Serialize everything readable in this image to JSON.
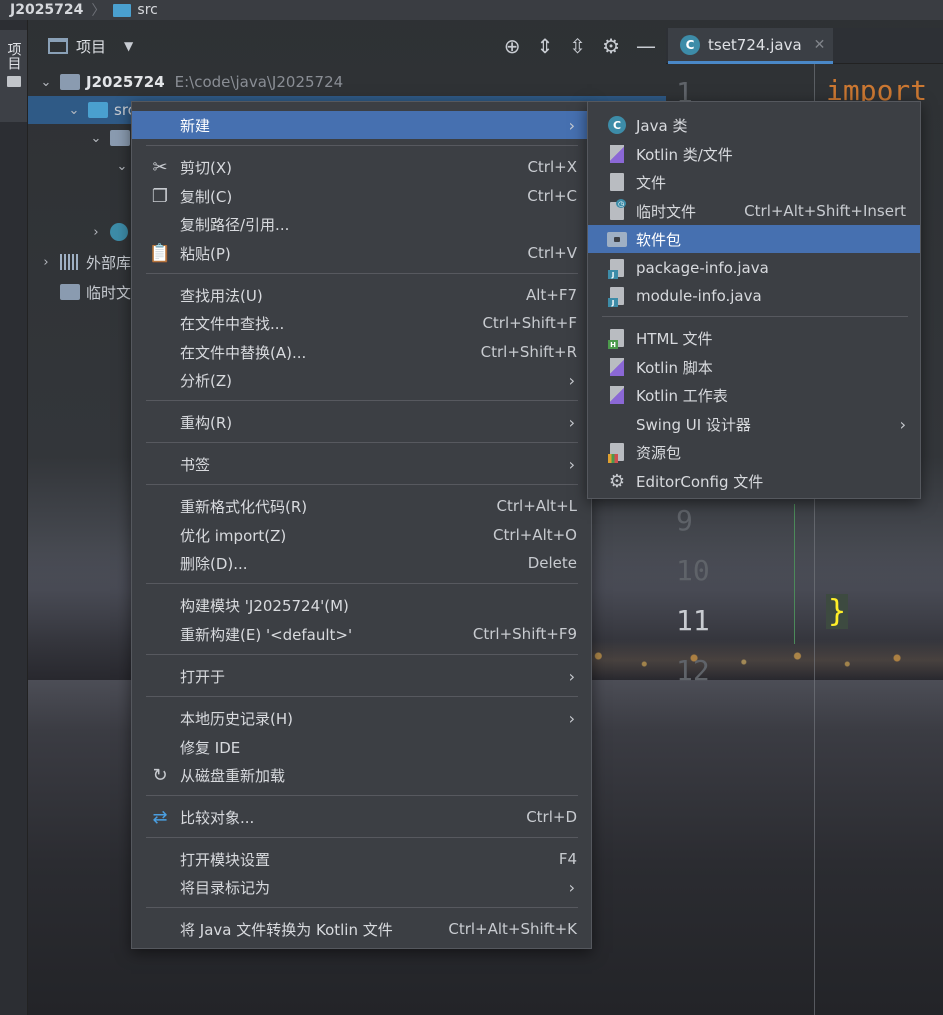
{
  "breadcrumb": {
    "root": "J2025724",
    "child": "src"
  },
  "toolstrip": {
    "tab_label": "项目"
  },
  "project_panel": {
    "title": "项目",
    "root_name": "J2025724",
    "root_path": "E:\\code\\java\\J2025724",
    "src_name": "src",
    "external_libs": "外部库",
    "scratches": "临时文件和控制台"
  },
  "editor": {
    "tab_name": "tset724.java",
    "line_numbers": [
      "1",
      "9",
      "10",
      "11",
      "12"
    ],
    "active_line": "11",
    "code_keyword": "import",
    "code_brace": "}"
  },
  "context_menu": {
    "items": [
      {
        "label": "新建",
        "shortcut": "",
        "submenu": true
      },
      {
        "label": "剪切(X)",
        "shortcut": "Ctrl+X",
        "icon": "scissors-icon"
      },
      {
        "label": "复制(C)",
        "shortcut": "Ctrl+C",
        "icon": "copy-icon"
      },
      {
        "label": "复制路径/引用...",
        "shortcut": ""
      },
      {
        "label": "粘贴(P)",
        "shortcut": "Ctrl+V",
        "icon": "paste-icon"
      },
      {
        "label": "查找用法(U)",
        "shortcut": "Alt+F7"
      },
      {
        "label": "在文件中查找...",
        "shortcut": "Ctrl+Shift+F"
      },
      {
        "label": "在文件中替换(A)...",
        "shortcut": "Ctrl+Shift+R"
      },
      {
        "label": "分析(Z)",
        "submenu": true
      },
      {
        "label": "重构(R)",
        "submenu": true
      },
      {
        "label": "书签",
        "submenu": true
      },
      {
        "label": "重新格式化代码(R)",
        "shortcut": "Ctrl+Alt+L"
      },
      {
        "label": "优化 import(Z)",
        "shortcut": "Ctrl+Alt+O"
      },
      {
        "label": "删除(D)...",
        "shortcut": "Delete"
      },
      {
        "label": "构建模块 'J2025724'(M)",
        "shortcut": ""
      },
      {
        "label": "重新构建(E) '<default>'",
        "shortcut": "Ctrl+Shift+F9"
      },
      {
        "label": "打开于",
        "submenu": true
      },
      {
        "label": "本地历史记录(H)",
        "submenu": true
      },
      {
        "label": "修复 IDE",
        "shortcut": ""
      },
      {
        "label": "从磁盘重新加载",
        "shortcut": "",
        "icon": "reload-icon"
      },
      {
        "label": "比较对象...",
        "shortcut": "Ctrl+D",
        "icon": "compare-icon"
      },
      {
        "label": "打开模块设置",
        "shortcut": "F4"
      },
      {
        "label": "将目录标记为",
        "submenu": true
      },
      {
        "label": "将 Java 文件转换为 Kotlin 文件",
        "shortcut": "Ctrl+Alt+Shift+K"
      }
    ]
  },
  "new_submenu": {
    "items": [
      {
        "label": "Java 类",
        "shortcut": ""
      },
      {
        "label": "Kotlin 类/文件",
        "shortcut": ""
      },
      {
        "label": "文件",
        "shortcut": ""
      },
      {
        "label": "临时文件",
        "shortcut": "Ctrl+Alt+Shift+Insert"
      },
      {
        "label": "软件包",
        "shortcut": ""
      },
      {
        "label": "package-info.java",
        "shortcut": ""
      },
      {
        "label": "module-info.java",
        "shortcut": ""
      },
      {
        "label": "HTML 文件",
        "shortcut": ""
      },
      {
        "label": "Kotlin 脚本",
        "shortcut": ""
      },
      {
        "label": "Kotlin 工作表",
        "shortcut": ""
      },
      {
        "label": "Swing UI 设计器",
        "submenu": true
      },
      {
        "label": "资源包",
        "shortcut": ""
      },
      {
        "label": "EditorConfig 文件",
        "shortcut": ""
      }
    ]
  },
  "colors": {
    "highlight": "#4670b0",
    "menu_bg": "#3c3f44",
    "selection": "#2f5a86"
  }
}
